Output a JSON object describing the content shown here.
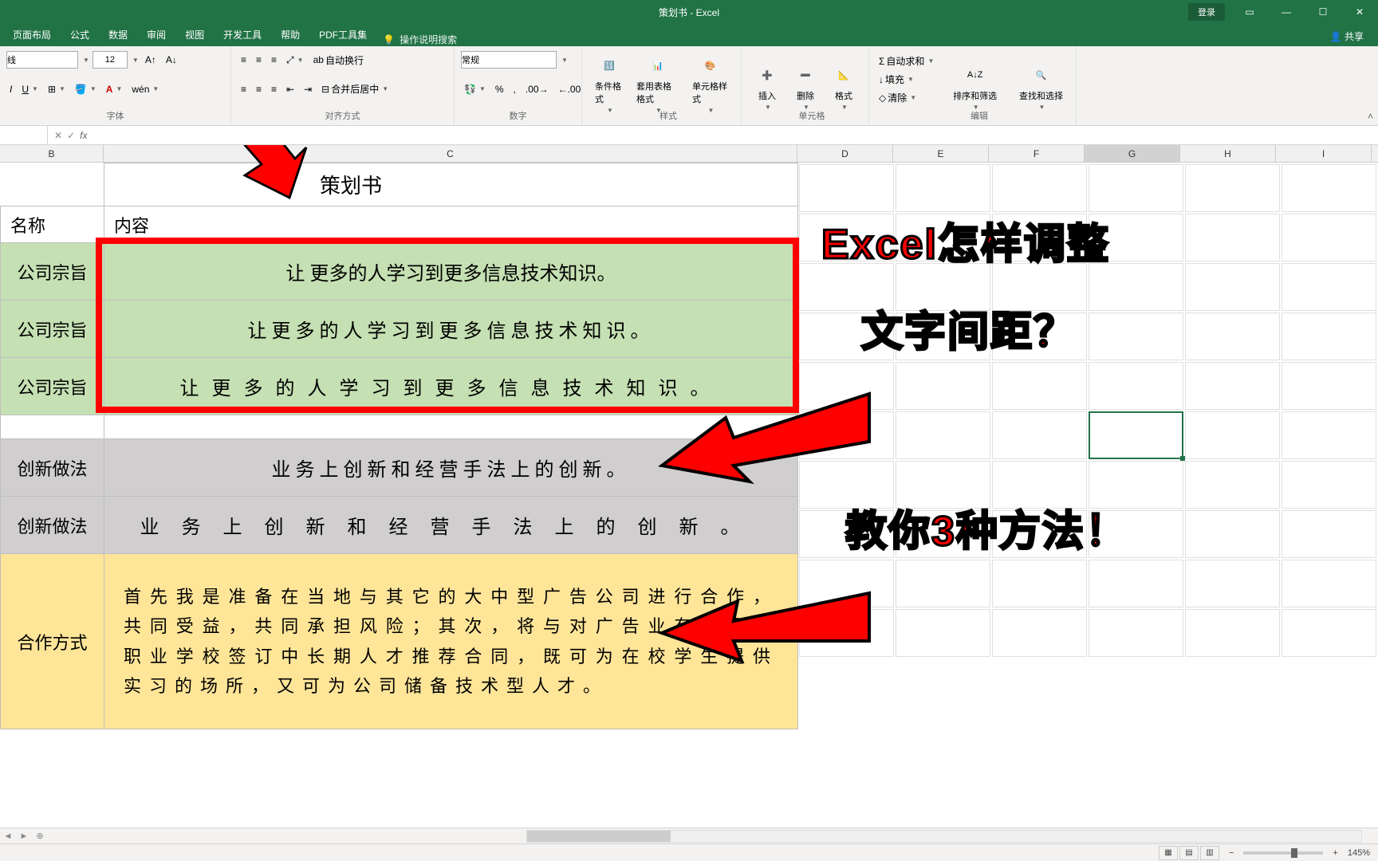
{
  "app": {
    "title": "策划书 - Excel",
    "login": "登录",
    "share": "共享"
  },
  "tabs": [
    "页面布局",
    "公式",
    "数据",
    "审阅",
    "视图",
    "开发工具",
    "帮助",
    "PDF工具集"
  ],
  "tellme": "操作说明搜索",
  "ribbon": {
    "font_group": "字体",
    "font_size": "12",
    "align_group": "对齐方式",
    "wrap": "自动换行",
    "merge": "合并后居中",
    "number_group": "数字",
    "number_format": "常规",
    "styles_group": "样式",
    "cond_fmt": "条件格式",
    "table_fmt": "套用表格格式",
    "cell_styles": "单元格样式",
    "cells_group": "单元格",
    "insert": "插入",
    "delete": "删除",
    "format": "格式",
    "edit_group": "编辑",
    "autosum": "自动求和",
    "fill": "填充",
    "clear": "清除",
    "sort": "排序和筛选",
    "find": "查找和选择"
  },
  "columns": [
    "B",
    "C",
    "D",
    "E",
    "F",
    "G",
    "H",
    "I"
  ],
  "sheet": {
    "title": "策划书",
    "hdr_name": "名称",
    "hdr_content": "内容",
    "rows": [
      {
        "label": "公司宗旨",
        "content": "让 更多的人学习到更多信息技术知识。",
        "bg": "green",
        "sp": ""
      },
      {
        "label": "公司宗旨",
        "content": "让更多的人学习到更多信息技术知识。",
        "bg": "green",
        "sp": "sp2"
      },
      {
        "label": "公司宗旨",
        "content": "让更多的人学习到更多信息技术知识。",
        "bg": "green",
        "sp": "sp3"
      },
      {
        "label": "创新做法",
        "content": "业务上创新和经营手法上的创新。",
        "bg": "gray",
        "sp": "sp2"
      },
      {
        "label": "创新做法",
        "content": "业务上创新和经营手法上的创新。",
        "bg": "gray",
        "sp": "sp4"
      },
      {
        "label": "合作方式",
        "content": "首先我是准备在当地与其它的大中型广告公司进行合作，共同受益，共同承担风险；其次，将与对广告业有兴趣的职业学校签订中长期人才推荐合同，既可为在校学生提供实习的场所，又可为公司储备技术型人才。",
        "bg": "yellow",
        "sp": "para"
      }
    ]
  },
  "anno": {
    "line1": "Excel怎样调整",
    "line2": "文字间距？",
    "line3": "教你3种方法！"
  },
  "status": {
    "zoom": "145%"
  }
}
